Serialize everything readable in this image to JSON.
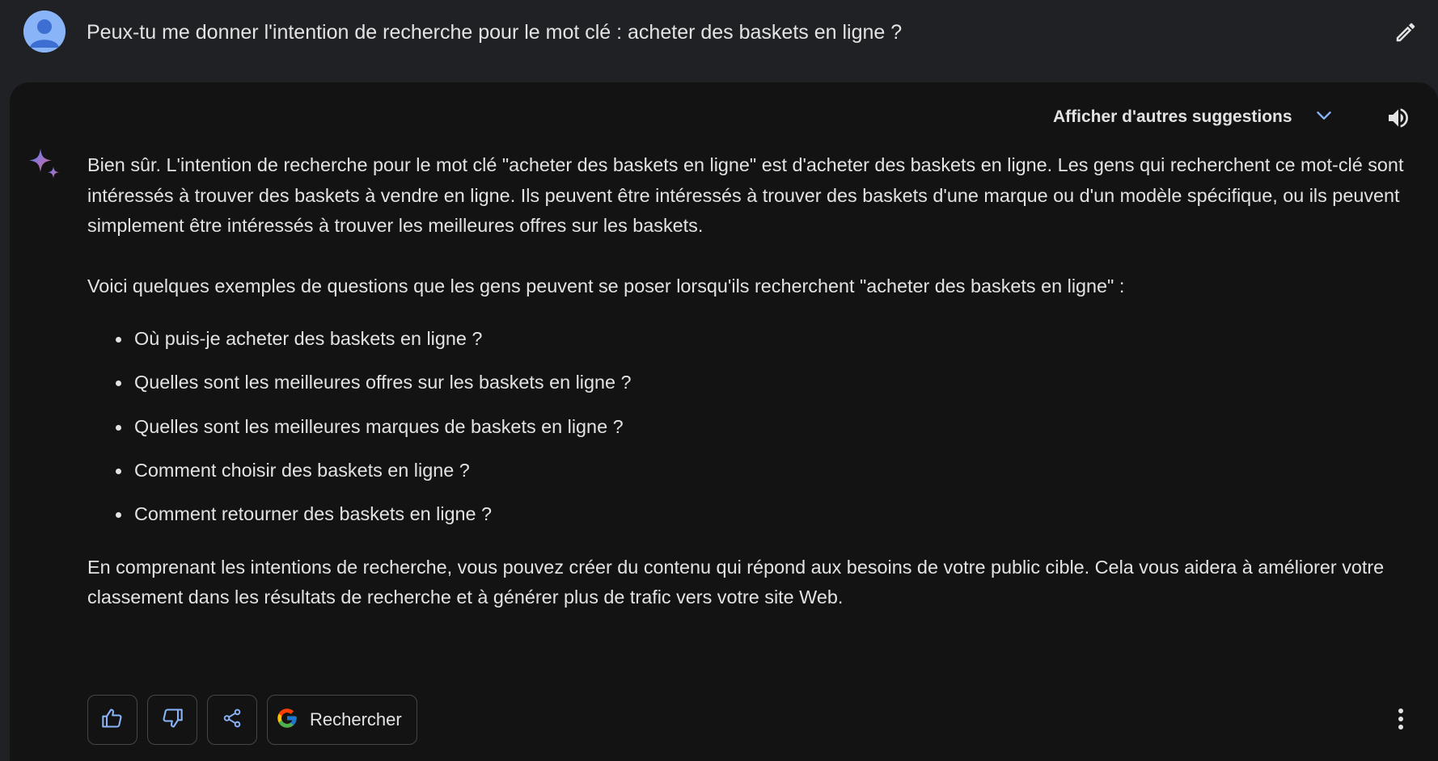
{
  "prompt": {
    "text": "Peux-tu me donner l'intention de recherche pour le mot clé : acheter des baskets en ligne ?",
    "avatar_icon": "user-avatar-icon",
    "edit_icon": "pencil-icon"
  },
  "response": {
    "suggestions_label": "Afficher d'autres suggestions",
    "suggestions_icon": "chevron-down-icon",
    "speaker_icon": "volume-icon",
    "assistant_icon": "sparkle-icon",
    "paragraph_1": "Bien sûr. L'intention de recherche pour le mot clé \"acheter des baskets en ligne\" est d'acheter des baskets en ligne. Les gens qui recherchent ce mot-clé sont intéressés à trouver des baskets à vendre en ligne. Ils peuvent être intéressés à trouver des baskets d'une marque ou d'un modèle spécifique, ou ils peuvent simplement être intéressés à trouver les meilleures offres sur les baskets.",
    "paragraph_2": "Voici quelques exemples de questions que les gens peuvent se poser lorsqu'ils recherchent \"acheter des baskets en ligne\" :",
    "bullets": [
      "Où puis-je acheter des baskets en ligne ?",
      "Quelles sont les meilleures offres sur les baskets en ligne ?",
      "Quelles sont les meilleures marques de baskets en ligne ?",
      "Comment choisir des baskets en ligne ?",
      "Comment retourner des baskets en ligne ?"
    ],
    "paragraph_3": "En comprenant les intentions de recherche, vous pouvez créer du contenu qui répond aux besoins de votre public cible. Cela vous aidera à améliorer votre classement dans les résultats de recherche et à générer plus de trafic vers votre site Web."
  },
  "actions": {
    "thumbs_up_icon": "thumbs-up-icon",
    "thumbs_down_icon": "thumbs-down-icon",
    "share_icon": "share-icon",
    "search_icon": "google-g-icon",
    "search_label": "Rechercher",
    "more_icon": "more-vertical-icon"
  },
  "colors": {
    "page_background": "#202124",
    "card_background": "#131314",
    "text": "#e3e3e3",
    "accent": "#8ab4f8",
    "button_border": "#444746"
  }
}
